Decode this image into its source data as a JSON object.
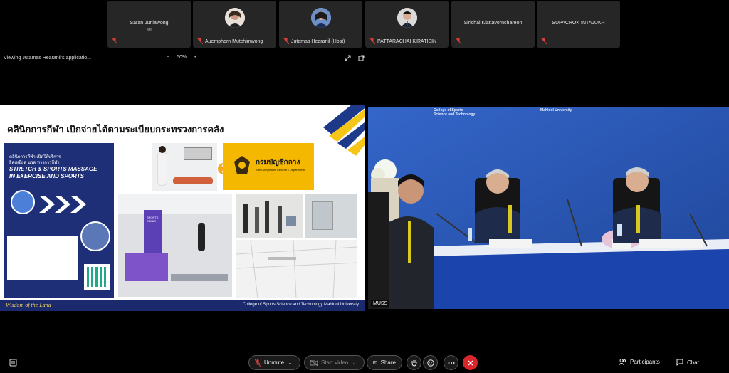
{
  "participants": [
    {
      "name": "Saran Junlawong",
      "sub": "Me",
      "label": ""
    },
    {
      "name": "",
      "sub": "",
      "label": "Auemphorn Mutchimwong"
    },
    {
      "name": "",
      "sub": "",
      "label": "Jutamas Hearanil (Host)"
    },
    {
      "name": "",
      "sub": "",
      "label": "PATTARACHAI KIRATISIN"
    },
    {
      "name": "Sirichai Kiattavornchareon",
      "sub": "",
      "label": ""
    },
    {
      "name": "SUPACHOK INTAJUKR",
      "sub": "",
      "label": ""
    }
  ],
  "viewbar": {
    "title": "Viewing Jutamas Hearanil's applicatio...",
    "zoom_minus": "−",
    "zoom": "50%",
    "zoom_plus": "+"
  },
  "slide": {
    "title": "คลินิกการกีฬา เบิกจ่ายได้ตามระเบียบกระทรวงการคลัง",
    "poster_line1": "คลินิกการกีฬา เปิดให้บริการ",
    "poster_line2": "ยืดเหยียด นวด ทางการกีฬา",
    "poster_head1": "STRETCH & SPORTS MASSAGE",
    "poster_head2": "IN EXERCISE AND SPORTS",
    "cgd_name": "กรมบัญชีกลาง",
    "cgd_sub": "The Comptroller General's Department",
    "clinic_sign": "SPORTS CLINIC",
    "footer_left": "Wisdom of the Land",
    "footer_right": "College of Sports Science and Technology  Mahidol University"
  },
  "video": {
    "label": "MUSS",
    "banner1": "College of Sports Science and Technology",
    "banner2": "Mahidol University"
  },
  "toolbar": {
    "unmute": "Unmute",
    "start_video": "Start video",
    "share": "Share",
    "participants": "Participants",
    "chat": "Chat"
  },
  "colors": {
    "end_button": "#d9262c",
    "slide_footer": "#1a2a6c",
    "muted_mic": "#e0403a"
  }
}
